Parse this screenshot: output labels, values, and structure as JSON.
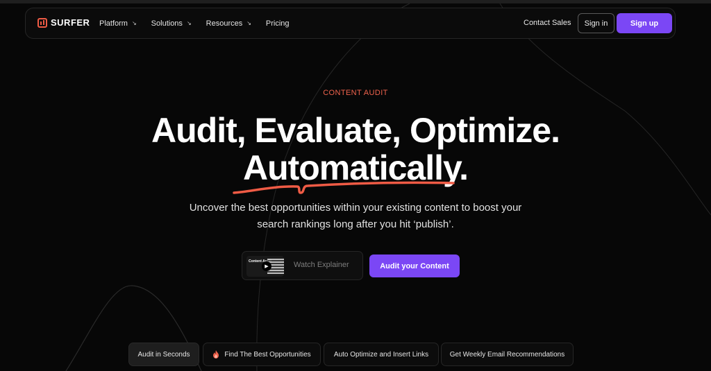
{
  "nav": {
    "brand": "SURFER",
    "menu": [
      {
        "label": "Platform",
        "has_dropdown": true
      },
      {
        "label": "Solutions",
        "has_dropdown": true
      },
      {
        "label": "Resources",
        "has_dropdown": true
      },
      {
        "label": "Pricing",
        "has_dropdown": false
      }
    ],
    "dropdown_glyph": "↘",
    "contact": "Contact Sales",
    "signin": "Sign in",
    "signup": "Sign up"
  },
  "hero": {
    "eyebrow": "CONTENT AUDIT",
    "headline_line1": "Audit, Evaluate, Optimize.",
    "headline_line2": "Automatically.",
    "subtitle_line1": "Uncover the best opportunities within your existing content to boost your",
    "subtitle_line2": "search rankings long after you hit ‘publish’.",
    "video_thumb_text": "Content Audit",
    "watch_label": "Watch Explainer",
    "cta": "Audit your Content"
  },
  "tabs": [
    {
      "label": "Audit in Seconds",
      "active": true
    },
    {
      "label": "Find The Best Opportunities",
      "icon": "fire-icon"
    },
    {
      "label": "Auto Optimize and Insert Links"
    },
    {
      "label": "Get Weekly Email Recommendations"
    }
  ],
  "colors": {
    "accent": "#7b47f5",
    "brand": "#ef5b45",
    "eyebrow": "#f0634d",
    "background": "#070707"
  }
}
